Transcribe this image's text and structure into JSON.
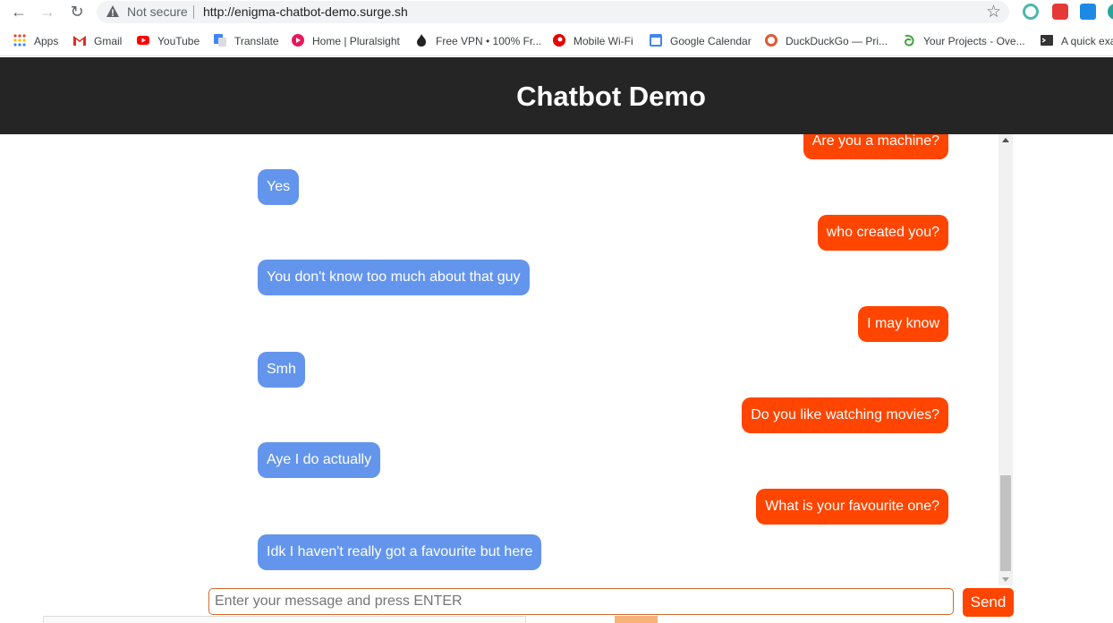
{
  "browser": {
    "security_label": "Not secure",
    "url": "http://enigma-chatbot-demo.surge.sh"
  },
  "bookmarks": [
    {
      "label": "Apps",
      "icon": "apps-grid-icon",
      "color": "#ea4335"
    },
    {
      "label": "Gmail",
      "icon": "gmail-icon",
      "color": "#d93025"
    },
    {
      "label": "YouTube",
      "icon": "youtube-icon",
      "color": "#ff0000"
    },
    {
      "label": "Translate",
      "icon": "translate-icon",
      "color": "#4285f4"
    },
    {
      "label": "Home | Pluralsight",
      "icon": "pluralsight-icon",
      "color": "#e8175d"
    },
    {
      "label": "Free VPN • 100% Fr...",
      "icon": "fire-icon",
      "color": "#222222"
    },
    {
      "label": "Mobile Wi-Fi",
      "icon": "vodafone-icon",
      "color": "#e60000"
    },
    {
      "label": "Google Calendar",
      "icon": "calendar-icon",
      "color": "#4285f4"
    },
    {
      "label": "DuckDuckGo — Pri...",
      "icon": "duckduckgo-icon",
      "color": "#de5833"
    },
    {
      "label": "Your Projects - Ove...",
      "icon": "overleaf-icon",
      "color": "#47a141"
    },
    {
      "label": "A quick exa",
      "icon": "terminal-icon",
      "color": "#333333"
    }
  ],
  "header": {
    "title": "Chatbot Demo"
  },
  "messages": [
    {
      "sender": "user",
      "text": "Are you a machine?"
    },
    {
      "sender": "bot",
      "text": "Yes"
    },
    {
      "sender": "user",
      "text": "who created you?"
    },
    {
      "sender": "bot",
      "text": "You don't know too much about that guy"
    },
    {
      "sender": "user",
      "text": "I may know"
    },
    {
      "sender": "bot",
      "text": "Smh"
    },
    {
      "sender": "user",
      "text": "Do you like watching movies?"
    },
    {
      "sender": "bot",
      "text": "Aye I do actually"
    },
    {
      "sender": "user",
      "text": "What is your favourite one?"
    },
    {
      "sender": "bot",
      "text": "Idk I haven't really got a favourite but here"
    }
  ],
  "composer": {
    "placeholder": "Enter your message and press ENTER",
    "value": "",
    "send_label": "Send"
  },
  "colors": {
    "header_bg": "#252525",
    "bot_bubble": "#6495ed",
    "user_bubble": "#ff4500",
    "send_button": "#ff4500"
  }
}
